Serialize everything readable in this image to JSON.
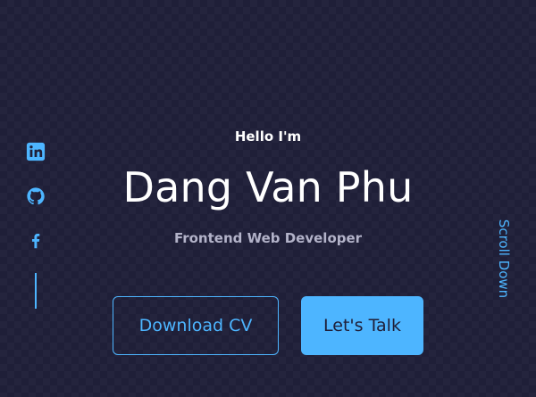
{
  "hero": {
    "greeting": "Hello I'm",
    "name": "Dang Van Phu",
    "role": "Frontend Web Developer"
  },
  "buttons": {
    "download_cv": "Download CV",
    "lets_talk": "Let's Talk"
  },
  "socials": [
    {
      "icon": "linkedin-icon"
    },
    {
      "icon": "github-icon"
    },
    {
      "icon": "facebook-icon"
    }
  ],
  "scroll": {
    "label": "Scroll Down"
  },
  "colors": {
    "background": "#1f1f38",
    "accent": "#4db5ff",
    "text": "#ffffff",
    "muted": "#b3b3c9"
  }
}
